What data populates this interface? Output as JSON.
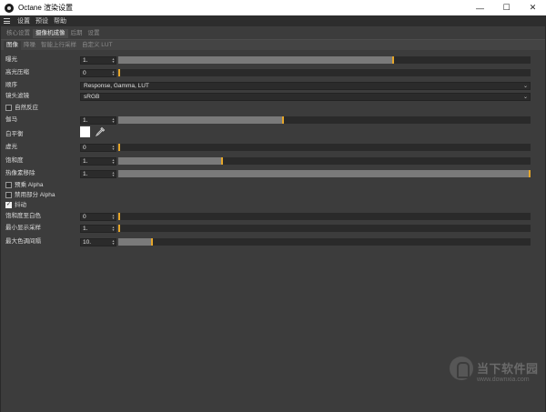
{
  "window": {
    "title": "Octane 渲染设置",
    "minimize": "—",
    "maximize": "☐",
    "close": "✕"
  },
  "menu": [
    "设置",
    "预设",
    "帮助"
  ],
  "tabs_primary": [
    "核心设置",
    "摄像机成像",
    "后期",
    "设置"
  ],
  "tabs_primary_active": 1,
  "tabs_secondary": [
    "图像",
    "降噪",
    "智能上行采样",
    "自定义 LUT"
  ],
  "tabs_secondary_active": 0,
  "params": {
    "exposure": {
      "label": "曝光",
      "value": "1.",
      "level": 0.668
    },
    "highlight_compression": {
      "label": "高光压缩",
      "value": "0",
      "level": 0.0
    },
    "order": {
      "label": "顺序",
      "value": "Response, Gamma, LUT"
    },
    "camera_filter": {
      "label": "镜头滤镜",
      "value": "sRGB"
    },
    "natural_response": {
      "label": "自然反应",
      "checked": false
    },
    "gamma": {
      "label": "伽马",
      "value": "1.",
      "level": 0.4
    },
    "white_balance": {
      "label": "白平衡",
      "color": "#ffffff"
    },
    "vignetting": {
      "label": "虚光",
      "value": "0",
      "level": 0.0
    },
    "saturation": {
      "label": "饱和度",
      "value": "1.",
      "level": 0.25
    },
    "hot_pixel_removal": {
      "label": "热像素移除",
      "value": "1.",
      "level": 1.0
    },
    "premultiplied_alpha": {
      "label": "预乘 Alpha",
      "checked": false
    },
    "disable_partial_alpha": {
      "label": "禁用部分 Alpha",
      "checked": false
    },
    "dithering": {
      "label": "抖动",
      "checked": true
    },
    "saturate_to_white": {
      "label": "饱和度至白色",
      "value": "0",
      "level": 0.0
    },
    "min_display_samples": {
      "label": "最小显示采样",
      "value": "1.",
      "level": 0.0
    },
    "max_tonemap_interval": {
      "label": "最大色调间隔",
      "value": "10.",
      "level": 0.08
    }
  },
  "watermark": {
    "brand": "当下软件园",
    "url": "www.downxia.com"
  },
  "colors": {
    "accent": "#e5a62a",
    "panel": "#3c3c3c",
    "track": "#2a2a2a",
    "fill": "#7a7a7a"
  }
}
